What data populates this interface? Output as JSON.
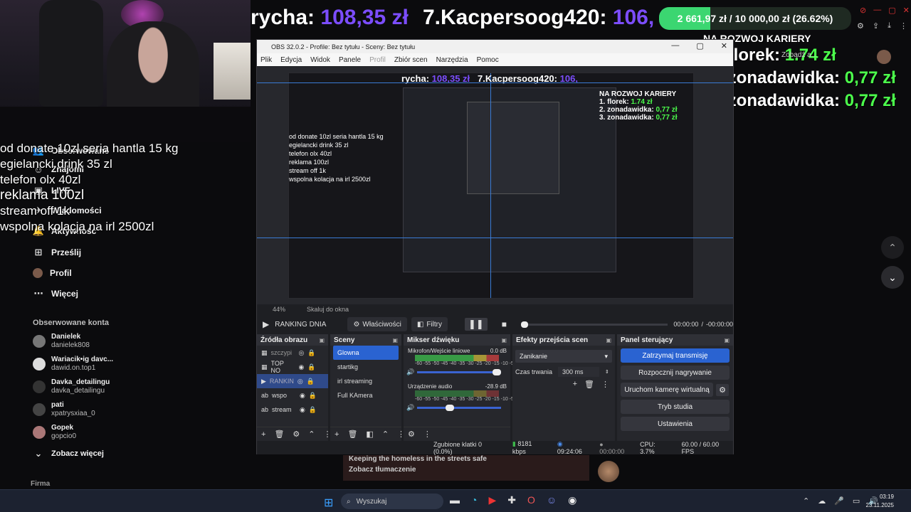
{
  "donations_overlay": [
    "od donate 10zl seria hantla 15 kg",
    "egielancki drink 35 zl",
    "telefon olx 40zl",
    "reklama 100zl",
    "stream off 1k",
    "wspolna kolacja na irl 2500zl"
  ],
  "sidebar": {
    "items": [
      {
        "label": "Obserwowane",
        "icon": "users-icon"
      },
      {
        "label": "Znajomi",
        "icon": "friends-icon"
      },
      {
        "label": "LIVE",
        "icon": "live-icon"
      },
      {
        "label": "Wiadomości",
        "icon": "message-icon"
      },
      {
        "label": "Aktywność",
        "icon": "bell-icon"
      },
      {
        "label": "Prześlij",
        "icon": "upload-icon"
      },
      {
        "label": "Profil",
        "icon": "profile-icon"
      },
      {
        "label": "Więcej",
        "icon": "more-icon"
      }
    ],
    "following_header": "Obserwowane konta",
    "accounts": [
      {
        "name": "Danielek",
        "handle": "danielek808"
      },
      {
        "name": "Wariacik•ig davc...",
        "handle": "dawid.on.top1"
      },
      {
        "name": "Davka_detailingu",
        "handle": "davka_detailingu"
      },
      {
        "name": "pati",
        "handle": "xpatrysxiaa_0"
      },
      {
        "name": "Gopek",
        "handle": "gopcio0"
      }
    ],
    "see_more": "Zobacz więcej",
    "footer": "Firma"
  },
  "ticker": {
    "left_name": "rycha:",
    "left_amount": "108,35 zł",
    "right_name": "7.Kacpersoog420:",
    "right_amount": "106,",
    "goal_text": "2 661,97 zł / 10 000,00 zł (26.62%)",
    "goal_fraction": 0.2662
  },
  "ranking": {
    "header": "NA ROZWOJ KARIERY",
    "rows": [
      {
        "name": "1. florek:",
        "value": "1.74 zł"
      },
      {
        "name": "2. zonadawidka:",
        "value": "0,77 zł"
      },
      {
        "name": "3. zonadawidka:",
        "value": "0,77 zł"
      }
    ],
    "overlay_label": "Zobądź a..."
  },
  "obs": {
    "title": "OBS 32.0.2 - Profile: Bez tytułu - Sceny: Bez tytułu",
    "menu": [
      "Plik",
      "Edycja",
      "Widok",
      "Panele",
      "Profil",
      "Zbiór scen",
      "Narzędzia",
      "Pomoc"
    ],
    "zoom": "44%",
    "zoom_mode": "Skaluj do okna",
    "current_source": "RANKING DNIA",
    "properties_button": "Właściwości",
    "filters_button": "Filtry",
    "time": "00:00:00",
    "time_sep": "/",
    "time_total": "-00:00:00",
    "docks": {
      "sources_title": "Źródła obrazu",
      "sources": [
        {
          "label": "szczypi",
          "selected": false
        },
        {
          "label": "TOP NO",
          "selected": false
        },
        {
          "label": "RANKIN",
          "selected": true
        },
        {
          "label": "wspo",
          "selected": false
        },
        {
          "label": "stream",
          "selected": false
        }
      ],
      "scenes_title": "Sceny",
      "scenes": [
        {
          "label": "Glowna",
          "selected": true
        },
        {
          "label": "startikg",
          "selected": false
        },
        {
          "label": "irl streaming",
          "selected": false
        },
        {
          "label": "Full KAmera",
          "selected": false
        }
      ],
      "mixer_title": "Mikser dźwięku",
      "mixer": [
        {
          "label": "Mikrofon/Wejście liniowe",
          "db": "0.0 dB"
        },
        {
          "label": "Urządzenie audio",
          "db": "-28.9 dB"
        }
      ],
      "meter_scale": "-60 -55 -50 -45 -40 -35 -30 -25 -20 -15 -10 -5 0",
      "transitions_title": "Efekty przejścia scen",
      "transition": "Zanikanie",
      "duration_label": "Czas trwania",
      "duration": "300 ms",
      "controls_title": "Panel sterujący",
      "controls": [
        {
          "label": "Zatrzymaj transmisję",
          "primary": true
        },
        {
          "label": "Rozpocznij nagrywanie",
          "primary": false
        },
        {
          "label": "Uruchom kamerę wirtualną",
          "primary": false
        },
        {
          "label": "Tryb studia",
          "primary": false
        },
        {
          "label": "Ustawienia",
          "primary": false
        }
      ]
    },
    "status": {
      "dropped": "Zgubione klatki 0 (0.0%)",
      "bitrate": "8181 kbps",
      "live_time": "09:24:06",
      "rec_time": "00:00:00",
      "cpu": "CPU: 3.7%",
      "fps": "60.00 / 60.00 FPS"
    }
  },
  "chat": {
    "line1": "Keeping the homeless in the streets safe",
    "line2": "Zobacz tłumaczenie"
  },
  "taskbar": {
    "search_placeholder": "Wyszukaj",
    "time": "03:19",
    "date": "23.11.2025"
  },
  "colors": {
    "accent_purple": "#7c4dff",
    "accent_green": "#4cff4c",
    "obs_blue": "#2a63d1"
  }
}
